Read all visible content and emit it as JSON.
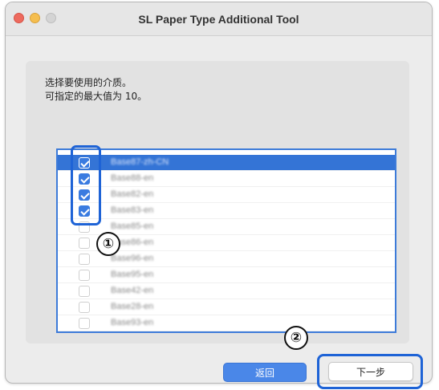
{
  "window": {
    "title": "SL Paper Type Additional Tool"
  },
  "instructions": {
    "line1": "选择要使用的介质。",
    "line2": "可指定的最大值为 10。"
  },
  "media_list": {
    "items": [
      {
        "label": "Base87-zh-CN",
        "checked": true,
        "selected": true
      },
      {
        "label": "Base88-en",
        "checked": true,
        "selected": false
      },
      {
        "label": "Base82-en",
        "checked": true,
        "selected": false
      },
      {
        "label": "Base83-en",
        "checked": true,
        "selected": false
      },
      {
        "label": "Base85-en",
        "checked": false,
        "selected": false
      },
      {
        "label": "Base86-en",
        "checked": false,
        "selected": false
      },
      {
        "label": "Base96-en",
        "checked": false,
        "selected": false
      },
      {
        "label": "Base95-en",
        "checked": false,
        "selected": false
      },
      {
        "label": "Base42-en",
        "checked": false,
        "selected": false
      },
      {
        "label": "Base28-en",
        "checked": false,
        "selected": false
      },
      {
        "label": "Base93-en",
        "checked": false,
        "selected": false
      }
    ]
  },
  "callouts": {
    "badge1": "①",
    "badge2": "②"
  },
  "buttons": {
    "back_label": "返回",
    "next_label": "下一步"
  },
  "colors": {
    "accent": "#3474d6",
    "callout": "#1e63d6"
  }
}
